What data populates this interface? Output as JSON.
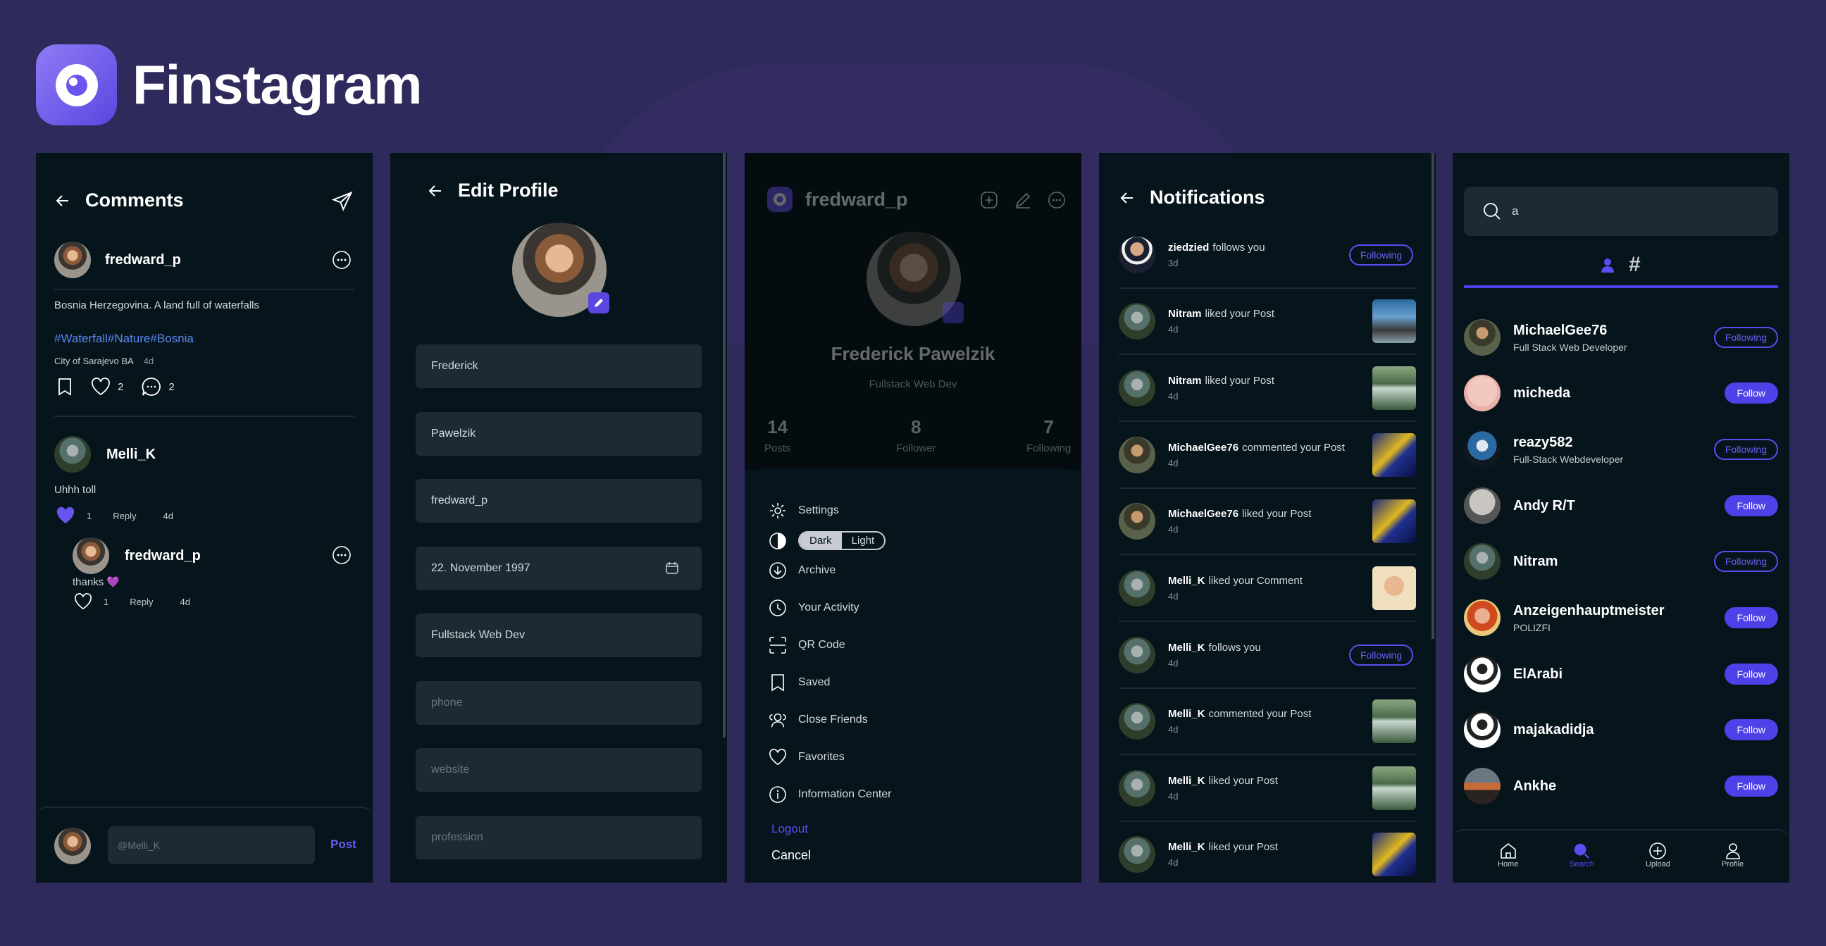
{
  "app": {
    "name": "Finstagram"
  },
  "colors": {
    "accent": "#4f41e8",
    "background": "#2e2a5b",
    "panel": "#06141b",
    "input": "#1c2a33",
    "hashtag": "#5a8af0"
  },
  "comments": {
    "title": "Comments",
    "post": {
      "username": "fredward_p",
      "caption": "Bosnia Herzegovina. A land full of waterfalls",
      "hashtags": "#Waterfall#Nature#Bosnia",
      "location": "City of Sarajevo BA",
      "age": "4d",
      "likes": "2",
      "comments": "2"
    },
    "comment": {
      "username": "Melli_K",
      "text": "Uhhh toll",
      "likes": "1",
      "reply": "Reply",
      "age": "4d"
    },
    "reply": {
      "username": "fredward_p",
      "text": "thanks 💜",
      "likes": "1",
      "reply": "Reply",
      "age": "4d"
    },
    "input": {
      "placeholder": "@Melli_K",
      "post_label": "Post"
    }
  },
  "edit_profile": {
    "title": "Edit Profile",
    "first_name": "Frederick",
    "last_name": "Pawelzik",
    "username": "fredward_p",
    "birthday": "22. November 1997",
    "bio": "Fullstack Web Dev",
    "phone_placeholder": "phone",
    "website_placeholder": "website",
    "profession_placeholder": "profession"
  },
  "profile": {
    "username": "fredward_p",
    "full_name": "Frederick Pawelzik",
    "bio": "Fullstack Web Dev",
    "stats": [
      {
        "value": "14",
        "label": "Posts"
      },
      {
        "value": "8",
        "label": "Follower"
      },
      {
        "value": "7",
        "label": "Following"
      }
    ],
    "menu": {
      "settings": "Settings",
      "theme_dark": "Dark",
      "theme_light": "Light",
      "archive": "Archive",
      "activity": "Your Activity",
      "qr": "QR Code",
      "saved": "Saved",
      "close_friends": "Close Friends",
      "favorites": "Favorites",
      "info": "Information Center",
      "logout": "Logout",
      "cancel": "Cancel"
    }
  },
  "notifications": {
    "title": "Notifications",
    "items": [
      {
        "user": "ziedzied",
        "text": "follows you",
        "age": "3d",
        "action": "Following",
        "avatar": "suit",
        "thumb": ""
      },
      {
        "user": "Nitram",
        "text": "liked your Post",
        "age": "4d",
        "action": "",
        "avatar": "green",
        "thumb": "th-d"
      },
      {
        "user": "Nitram",
        "text": "liked your Post",
        "age": "4d",
        "action": "",
        "avatar": "green",
        "thumb": "th-w"
      },
      {
        "user": "MichaelGee76",
        "text": "commented your Post",
        "age": "4d",
        "action": "",
        "avatar": "dark",
        "thumb": "th-b"
      },
      {
        "user": "MichaelGee76",
        "text": "liked your Post",
        "age": "4d",
        "action": "",
        "avatar": "dark",
        "thumb": "th-b"
      },
      {
        "user": "Melli_K",
        "text": "liked your Comment",
        "age": "4d",
        "action": "",
        "avatar": "green",
        "thumb": "th-p"
      },
      {
        "user": "Melli_K",
        "text": "follows you",
        "age": "4d",
        "action": "Following",
        "avatar": "green",
        "thumb": ""
      },
      {
        "user": "Melli_K",
        "text": "commented your Post",
        "age": "4d",
        "action": "",
        "avatar": "green",
        "thumb": "th-w"
      },
      {
        "user": "Melli_K",
        "text": "liked your Post",
        "age": "4d",
        "action": "",
        "avatar": "green",
        "thumb": "th-w"
      },
      {
        "user": "Melli_K",
        "text": "liked your Post",
        "age": "4d",
        "action": "",
        "avatar": "green",
        "thumb": "th-b"
      }
    ]
  },
  "search": {
    "query": "a",
    "users": [
      {
        "name": "MichaelGee76",
        "sub": "Full Stack Web Developer",
        "action": "Following",
        "avatar": "dark"
      },
      {
        "name": "micheda",
        "sub": "",
        "action": "Follow",
        "avatar": "pink"
      },
      {
        "name": "reazy582",
        "sub": "Full-Stack Webdeveloper",
        "action": "Following",
        "avatar": "blue"
      },
      {
        "name": "Andy R/T",
        "sub": "",
        "action": "Follow",
        "avatar": "bald"
      },
      {
        "name": "Nitram",
        "sub": "",
        "action": "Following",
        "avatar": "green"
      },
      {
        "name": "Anzeigenhauptmeister",
        "sub": "POLIZFI",
        "action": "Follow",
        "avatar": "red"
      },
      {
        "name": "ElArabi",
        "sub": "",
        "action": "Follow",
        "avatar": "white"
      },
      {
        "name": "majakadidja",
        "sub": "",
        "action": "Follow",
        "avatar": "white"
      },
      {
        "name": "Ankhe",
        "sub": "",
        "action": "Follow",
        "avatar": "sunset"
      }
    ],
    "nav": [
      {
        "label": "Home",
        "icon": "home-icon"
      },
      {
        "label": "Search",
        "icon": "search-icon"
      },
      {
        "label": "Upload",
        "icon": "upload-icon"
      },
      {
        "label": "Profile",
        "icon": "profile-icon"
      }
    ]
  }
}
